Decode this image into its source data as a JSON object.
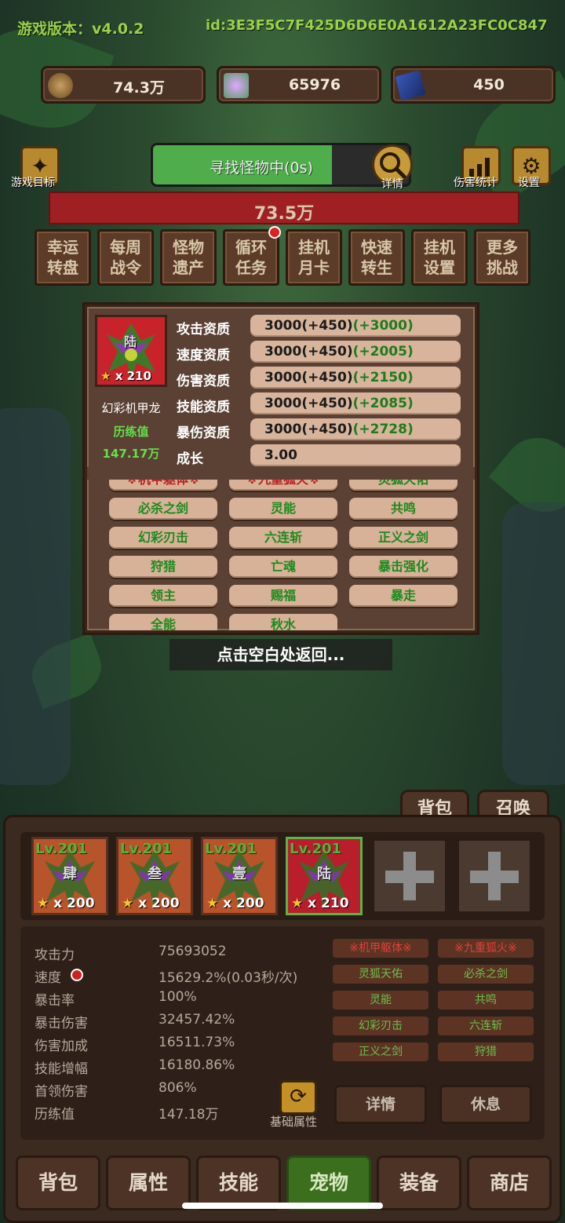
{
  "header": {
    "version_label": "游戏版本：v4.0.2",
    "id_label": "id:3E3F5C7F425D6D6E0A1612A23FC0C847"
  },
  "resources": [
    {
      "icon": "coin-icon",
      "value": "74.3万"
    },
    {
      "icon": "crystal-icon",
      "value": "65976"
    },
    {
      "icon": "card-icon",
      "value": "450"
    }
  ],
  "toolbar": {
    "game_goal": "游戏目标",
    "search_text": "寻找怪物中(0s)",
    "search_progress": 0.7,
    "detail": "详情",
    "damage_stats": "伤害统计",
    "settings": "设置"
  },
  "monster": {
    "hp": "73.5万"
  },
  "functions": [
    {
      "label": "幸运转盘",
      "badge": false
    },
    {
      "label": "每周战令",
      "badge": false
    },
    {
      "label": "怪物遗产",
      "badge": false
    },
    {
      "label": "循环任务",
      "badge": true
    },
    {
      "label": "挂机月卡",
      "badge": false
    },
    {
      "label": "快速转生",
      "badge": false
    },
    {
      "label": "挂机设置",
      "badge": false
    },
    {
      "label": "更多挑战",
      "badge": false
    }
  ],
  "popup": {
    "portrait_name": "陆",
    "stars": "x 210",
    "pet_name": "幻彩机甲龙",
    "exp_label": "历练值",
    "exp_value": "147.17万",
    "stats": [
      {
        "label": "攻击资质",
        "base": "3000",
        "plus1": "(+450)",
        "plus2": "(+3000)"
      },
      {
        "label": "速度资质",
        "base": "3000",
        "plus1": "(+450)",
        "plus2": "(+2005)"
      },
      {
        "label": "伤害资质",
        "base": "3000",
        "plus1": "(+450)",
        "plus2": "(+2150)"
      },
      {
        "label": "技能资质",
        "base": "3000",
        "plus1": "(+450)",
        "plus2": "(+2085)"
      },
      {
        "label": "暴伤资质",
        "base": "3000",
        "plus1": "(+450)",
        "plus2": "(+2728)"
      },
      {
        "label": "成长",
        "base": "3.00",
        "plus1": "",
        "plus2": ""
      }
    ],
    "skills": [
      {
        "name": "※机甲躯体※",
        "red": true
      },
      {
        "name": "※九重狐火※",
        "red": true
      },
      {
        "name": "灵狐天佑",
        "red": false
      },
      {
        "name": "必杀之剑",
        "red": false
      },
      {
        "name": "灵能",
        "red": false
      },
      {
        "name": "共鸣",
        "red": false
      },
      {
        "name": "幻彩刃击",
        "red": false
      },
      {
        "name": "六连斩",
        "red": false
      },
      {
        "name": "正义之剑",
        "red": false
      },
      {
        "name": "狩猎",
        "red": false
      },
      {
        "name": "亡魂",
        "red": false
      },
      {
        "name": "暴击强化",
        "red": false
      },
      {
        "name": "领主",
        "red": false
      },
      {
        "name": "赐福",
        "red": false
      },
      {
        "name": "暴走",
        "red": false
      },
      {
        "name": "全能",
        "red": false
      },
      {
        "name": "秋水",
        "red": false
      }
    ],
    "return_tip": "点击空白处返回..."
  },
  "bottom": {
    "bag_tab": "背包",
    "summon_tab": "召唤",
    "pets": [
      {
        "level": "Lv.201",
        "name": "肆",
        "stars": "x 200",
        "active": false
      },
      {
        "level": "Lv.201",
        "name": "叁",
        "stars": "x 200",
        "active": false
      },
      {
        "level": "Lv.201",
        "name": "壹",
        "stars": "x 200",
        "active": false
      },
      {
        "level": "Lv.201",
        "name": "陆",
        "stars": "x 210",
        "active": true
      }
    ],
    "attributes": [
      {
        "label": "攻击力",
        "value": "75693052"
      },
      {
        "label": "速度",
        "value": "15629.2%(0.03秒/次)"
      },
      {
        "label": "暴击率",
        "value": "100%"
      },
      {
        "label": "暴击伤害",
        "value": "32457.42%"
      },
      {
        "label": "伤害加成",
        "value": "16511.73%"
      },
      {
        "label": "技能增幅",
        "value": "16180.86%"
      },
      {
        "label": "首领伤害",
        "value": "806%"
      },
      {
        "label": "历练值",
        "value": "147.18万"
      }
    ],
    "mini_skills": [
      {
        "name": "※机甲躯体※",
        "red": true
      },
      {
        "name": "※九重狐火※",
        "red": true
      },
      {
        "name": "灵狐天佑",
        "red": false
      },
      {
        "name": "必杀之剑",
        "red": false
      },
      {
        "name": "灵能",
        "red": false
      },
      {
        "name": "共鸣",
        "red": false
      },
      {
        "name": "幻彩刃击",
        "red": false
      },
      {
        "name": "六连斩",
        "red": false
      },
      {
        "name": "正义之剑",
        "red": false
      },
      {
        "name": "狩猎",
        "red": false
      }
    ],
    "base_attr": "基础属性",
    "detail_button": "详情",
    "rest_button": "休息"
  },
  "nav": [
    {
      "label": "背包",
      "active": false
    },
    {
      "label": "属性",
      "active": false
    },
    {
      "label": "技能",
      "active": false
    },
    {
      "label": "宠物",
      "active": true
    },
    {
      "label": "装备",
      "active": false
    },
    {
      "label": "商店",
      "active": false
    }
  ],
  "colors": {
    "accent_green": "#64e04a",
    "hp_red": "#a01f22",
    "active_tab": "#3b6f1e"
  }
}
